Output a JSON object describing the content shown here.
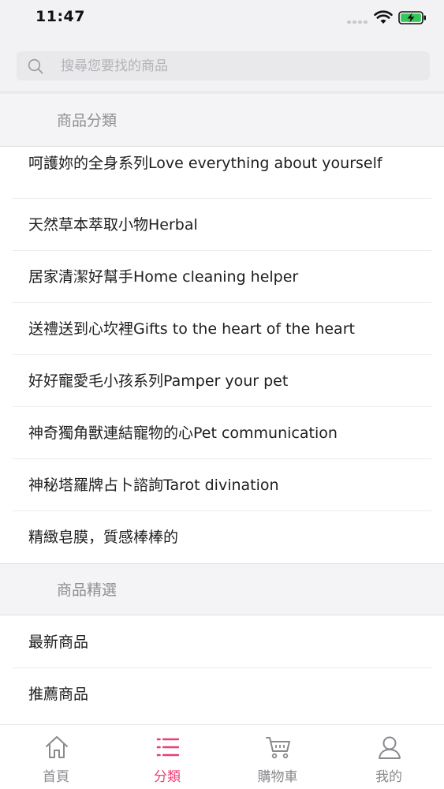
{
  "status_bar": {
    "time": "11:47"
  },
  "search": {
    "placeholder": "搜尋您要找的商品"
  },
  "sections": {
    "categories": {
      "title": "商品分類",
      "items": [
        "呵護妳的全身系列Love everything about yourself",
        "天然草本萃取小物Herbal",
        "居家清潔好幫手Home cleaning helper",
        "送禮送到心坎裡Gifts to the heart of the heart",
        "好好寵愛毛小孩系列Pamper your pet",
        "神奇獨角獸連結寵物的心Pet communication",
        "神秘塔羅牌占卜諮詢Tarot divination",
        "精緻皂膜，質感棒棒的"
      ]
    },
    "featured": {
      "title": "商品精選",
      "items": [
        "最新商品",
        "推薦商品"
      ]
    }
  },
  "tab_bar": {
    "tabs": [
      {
        "label": "首頁",
        "icon": "home-icon",
        "active": false
      },
      {
        "label": "分類",
        "icon": "list-icon",
        "active": true
      },
      {
        "label": "購物車",
        "icon": "cart-icon",
        "active": false
      },
      {
        "label": "我的",
        "icon": "user-icon",
        "active": false
      }
    ]
  },
  "colors": {
    "accent": "#ec3f74",
    "inactive": "#8a8a8e",
    "header_bg": "#f4f4f6"
  }
}
